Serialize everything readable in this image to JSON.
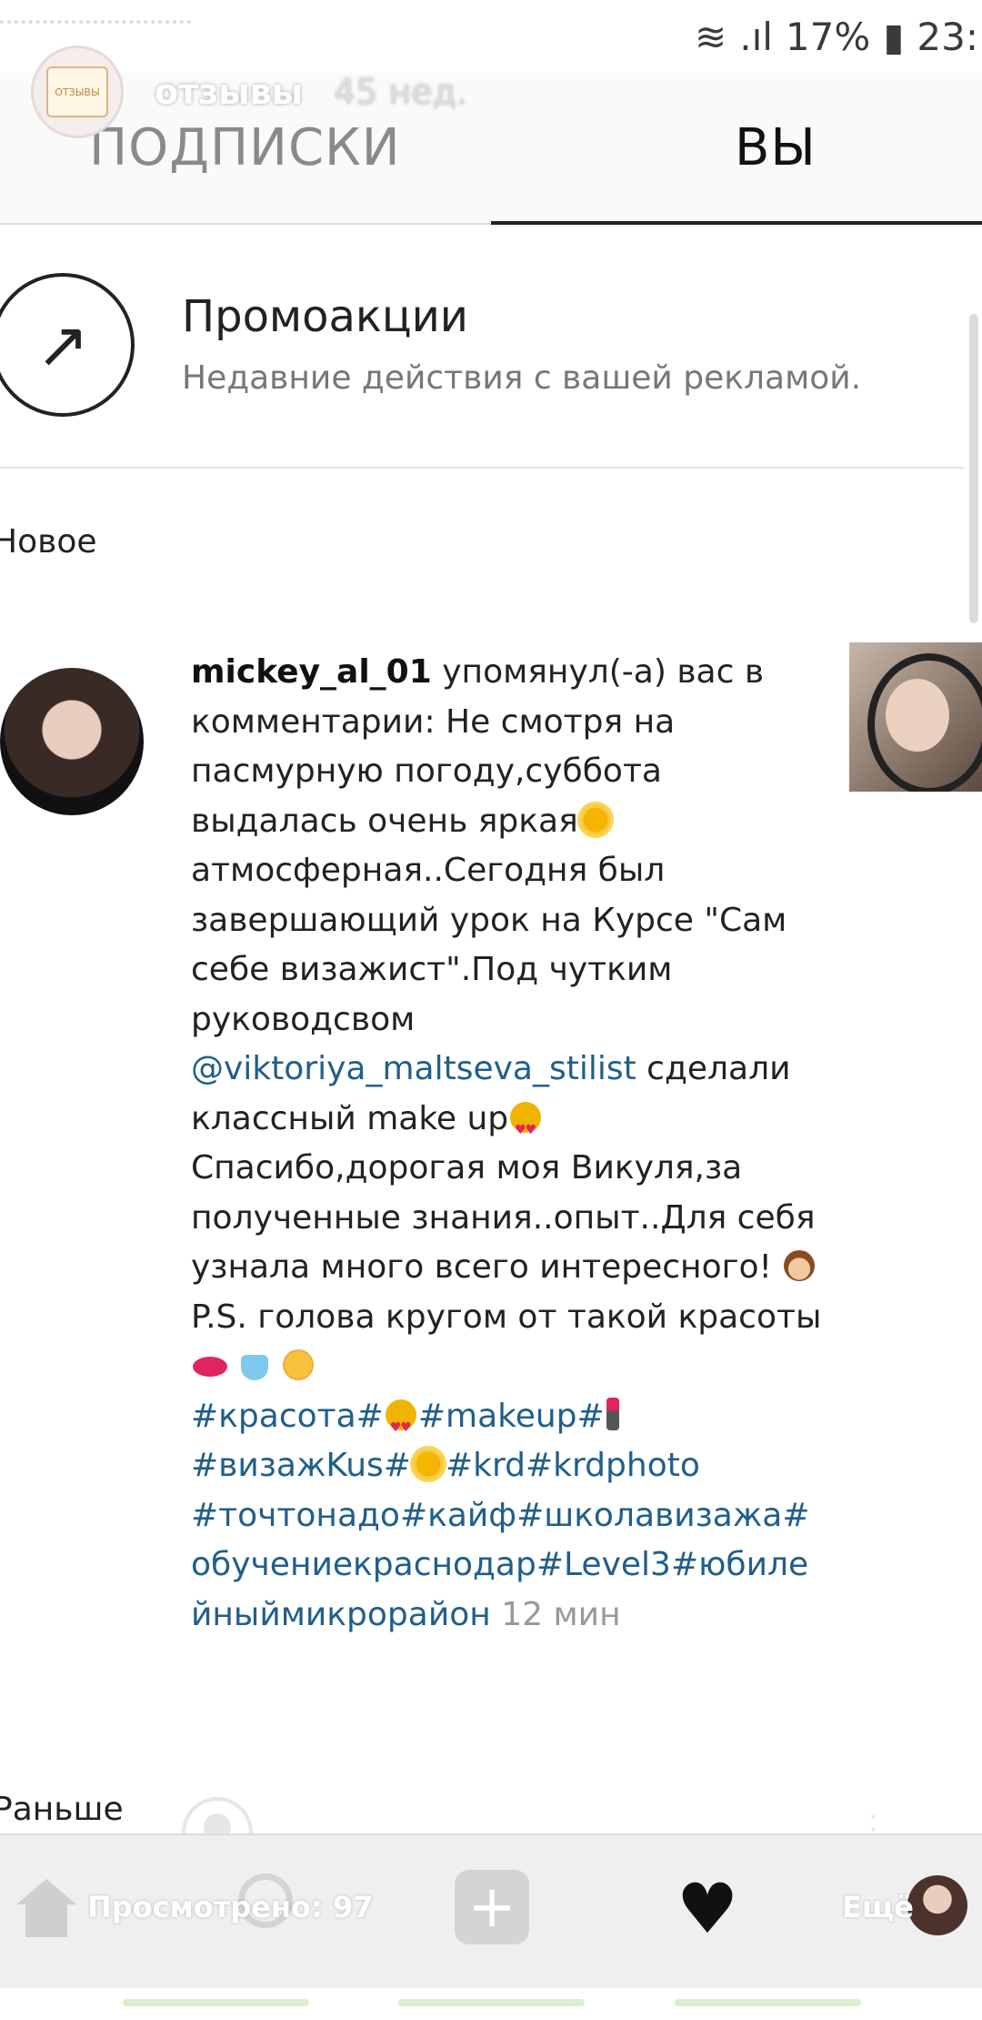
{
  "status_bar": {
    "wifi_icon": "wifi-icon",
    "signal_icon": "signal-icon",
    "battery_text": "17%",
    "battery_icon": "battery-icon",
    "time_text": "23:"
  },
  "story": {
    "avatar_text": "ОТЗЫВЫ",
    "account_name": "отзывы",
    "time": "45 нед."
  },
  "tabs": {
    "following": "ПОДПИСКИ",
    "you": "ВЫ"
  },
  "promo": {
    "title": "Промоакции",
    "subtitle": "Недавние действия с вашей рекламой."
  },
  "sections": {
    "new": "Новое",
    "earlier": "Раньше"
  },
  "notification": {
    "username": "mickey_al_01",
    "text_before_link": " упомянул(-а) вас в комментарии: Не смотря на пасмурную погоду,суббота выдалась очень яркая",
    "text_2": "атмосферная..Сегодня был завершающий урок на Курсе \"Сам себе визажист\".Под чутким руководсвом ",
    "mention": "@viktoriya_maltseva_stilist",
    "text_3": " сделали классный make up",
    "text_4": "Спасибо,дорогая моя Викуля,за полученные знания..опыт..Для себя узнала много всего интересного! ",
    "text_5": "P.S. голова кругом от такой красоты",
    "hashtag_1": "#красота#",
    "hashtag_2": "#makeup#",
    "hashtag_3": "#визажKus#",
    "hashtag_4": "#krd#krdphoto #точтонадо#кайф#школавизажа#обучениекраснодар#Level3#юбилейныймикрорайон",
    "time": " 12 мин"
  },
  "bottom_nav": {
    "views_label": "Просмотрено: 97",
    "more_label": "Ещё"
  },
  "colors": {
    "link": "#1f5f8b",
    "accent_dark": "#222222",
    "muted": "#8a8a8a"
  }
}
